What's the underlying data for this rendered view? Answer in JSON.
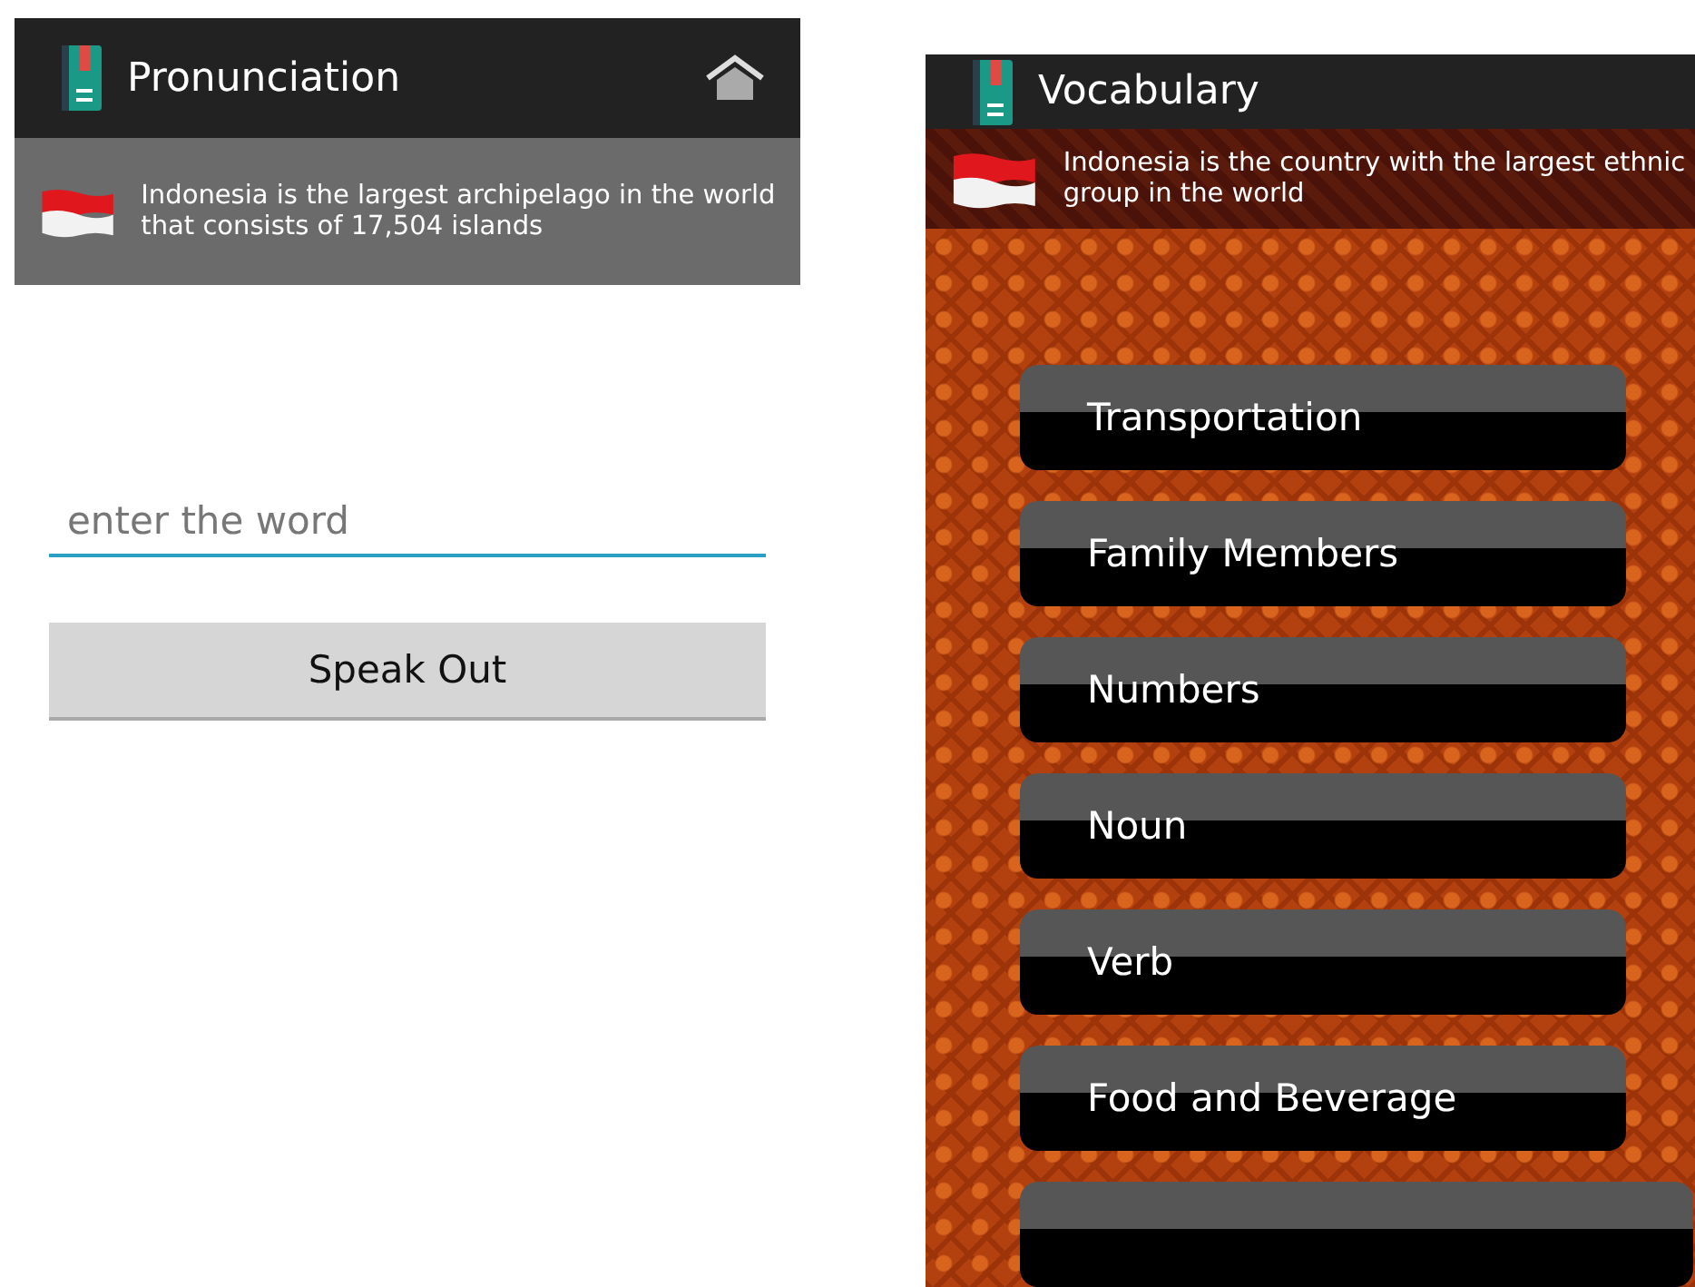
{
  "pronunciation": {
    "title": "Pronunciation",
    "fact": "Indonesia is the largest archipelago in the world that consists of 17,504 islands",
    "input": {
      "placeholder": "enter the word"
    },
    "button": "Speak Out"
  },
  "vocabulary": {
    "title": "Vocabulary",
    "fact": "Indonesia is the country with the largest ethnic group in the world",
    "categories": [
      {
        "label": "Transportation"
      },
      {
        "label": "Family Members"
      },
      {
        "label": "Numbers"
      },
      {
        "label": "Noun"
      },
      {
        "label": "Verb"
      },
      {
        "label": "Food and Beverage"
      }
    ]
  }
}
